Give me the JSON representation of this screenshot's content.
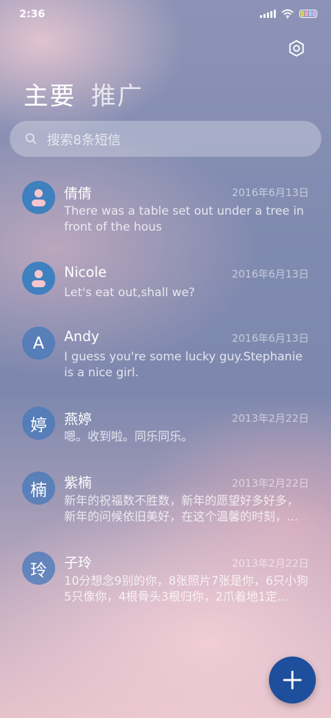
{
  "status_bar": {
    "time": "2:36"
  },
  "tabs": [
    {
      "label": "主要"
    },
    {
      "label": "推广"
    }
  ],
  "search": {
    "placeholder": "搜索8条短信"
  },
  "conversations": [
    {
      "avatar_type": "person-icon",
      "name": "倩倩",
      "date": "2016年6月13日",
      "preview": "There was a table set out under a tree in front of the hous"
    },
    {
      "avatar_type": "person-icon",
      "name": "Nicole",
      "date": "2016年6月13日",
      "preview": "Let's eat out,shall we?"
    },
    {
      "avatar_text": "A",
      "name": "Andy",
      "date": "2016年6月13日",
      "preview": "I guess you're some lucky guy.Stephanie is a nice girl."
    },
    {
      "avatar_text": "婷",
      "name": "燕婷",
      "date": "2013年2月22日",
      "preview": "嗯。收到啦。同乐同乐。"
    },
    {
      "avatar_text": "楠",
      "name": "紫楠",
      "date": "2013年2月22日",
      "preview": "新年的祝福数不胜数，新年的愿望好多好多，新年的问候依旧美好，在这个温馨的时刻，..."
    },
    {
      "avatar_text": "玲",
      "name": "子玲",
      "date": "2013年2月22日",
      "preview": "10分想念9别的你，8张照片7张是你，6只小狗5只像你，4根骨头3根归你，2爪着地1定..."
    }
  ],
  "colors": {
    "accent": "#3f80be",
    "fab": "#1d4f9c",
    "avatar_person_fill": "#f6c5cd"
  },
  "icons": {
    "settings": "gear-icon",
    "search": "search-icon",
    "compose": "plus-icon",
    "signal": "signal-icon",
    "wifi": "wifi-icon",
    "battery": "battery-icon"
  }
}
